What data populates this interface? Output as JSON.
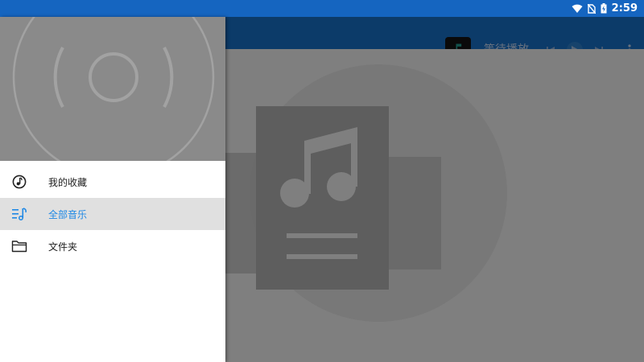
{
  "status_bar": {
    "time": "2:59",
    "icons": [
      "wifi-icon",
      "no-sim-icon",
      "battery-charging-icon"
    ]
  },
  "toolbar": {
    "now_playing": "等待播放",
    "buttons": [
      "previous-icon",
      "play-icon",
      "next-icon",
      "more-vert-icon"
    ]
  },
  "drawer": {
    "menu": [
      {
        "label": "我的收藏",
        "icon": "music-note-circle-icon",
        "selected": false
      },
      {
        "label": "全部音乐",
        "icon": "music-list-icon",
        "selected": true
      },
      {
        "label": "文件夹",
        "icon": "folder-icon",
        "selected": false
      }
    ]
  },
  "colors": {
    "status_bar": "#1565c0",
    "toolbar": "#1976d2",
    "accent": "#1e88e5",
    "selected_bg": "#e0e0e0",
    "drawer_header": "#8a8a8a"
  }
}
